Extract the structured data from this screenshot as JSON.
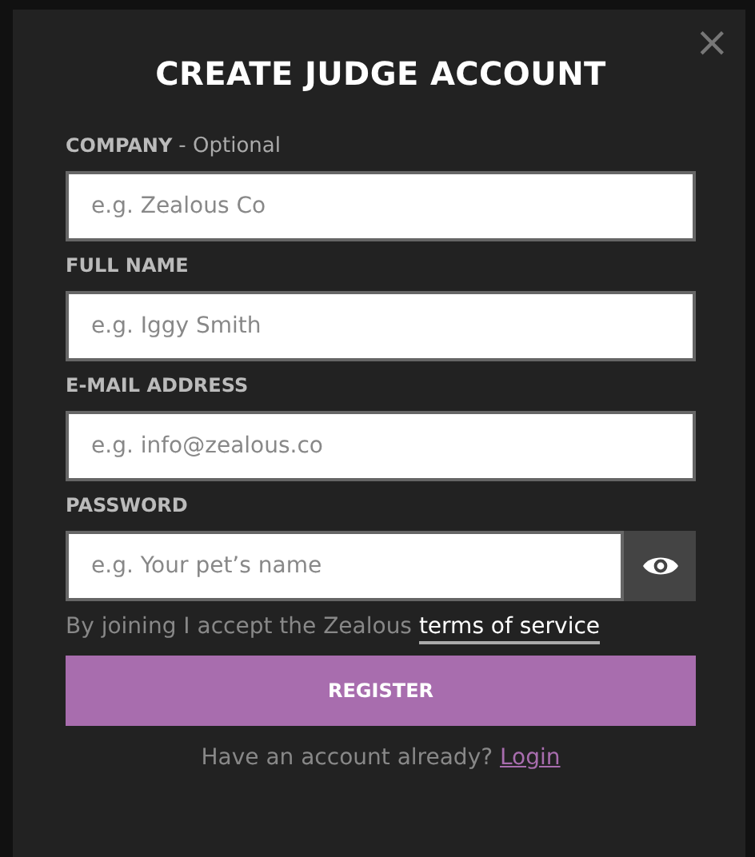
{
  "dialog": {
    "title": "CREATE JUDGE ACCOUNT",
    "close": "×"
  },
  "fields": [
    {
      "kind": "text",
      "label": "COMPANY",
      "note": "- Optional",
      "placeholder": "e.g. Zealous Co"
    },
    {
      "kind": "text",
      "label": "FULL NAME",
      "placeholder": "e.g. Iggy Smith"
    },
    {
      "kind": "text",
      "label": "E-MAIL ADDRESS",
      "placeholder": "e.g. info@zealous.co"
    },
    {
      "kind": "password",
      "label": "PASSWORD",
      "placeholder": "e.g. Your pet’s name"
    }
  ],
  "terms": {
    "text": "By joining I accept the Zealous",
    "link": "terms of service"
  },
  "register_button": "REGISTER",
  "login": {
    "text": "Have an account already?",
    "link": "Login"
  }
}
